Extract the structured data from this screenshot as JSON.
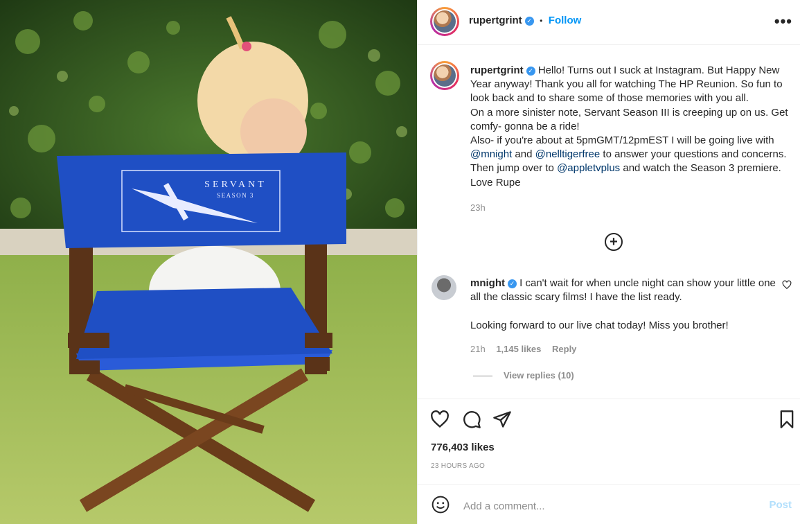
{
  "post": {
    "username": "rupertgrint",
    "verified_icon": "verified-badge-icon",
    "separator": "•",
    "follow_label": "Follow",
    "more_icon": "more-options-icon",
    "more_glyph": "•••"
  },
  "photo": {
    "chair_text_line1": "SERVANT",
    "chair_text_line2": "SEASON 3"
  },
  "caption": {
    "username": "rupertgrint",
    "text_1": " Hello! Turns out I suck at Instagram. But Happy New Year anyway! Thank you all for watching The HP Reunion. So fun to look back and to share some of those memories with you all.",
    "text_2": "On a more sinister note, Servant Season III is creeping up on us. Get comfy- gonna be a ride!",
    "text_3a": "Also- if you're about at 5pmGMT/12pmEST I will be going live with ",
    "mention_1": "@mnight",
    "text_3b": " and ",
    "mention_2": "@nelltigerfree",
    "text_3c": " to answer your questions and concerns. Then jump over to ",
    "mention_3": "@appletvplus",
    "text_3d": " and watch the Season 3 premiere. Love Rupe",
    "time": "23h"
  },
  "load_more_glyph": "+",
  "comment": {
    "username": "mnight",
    "text_1": " I can't wait for when uncle night can show your little one all the classic scary films! I have the list ready.",
    "text_2": "Looking forward to our live chat today! Miss you brother!",
    "time": "21h",
    "likes": "1,145 likes",
    "reply_label": "Reply",
    "view_replies": "View replies (10)"
  },
  "actions": {
    "like_icon": "heart-icon",
    "comment_icon": "comment-bubble-icon",
    "share_icon": "paper-plane-icon",
    "save_icon": "bookmark-icon"
  },
  "stats": {
    "likes": "776,403 likes",
    "time_ago": "23 HOURS AGO"
  },
  "comment_box": {
    "placeholder": "Add a comment...",
    "post_label": "Post"
  },
  "colors": {
    "accent": "#0095f6",
    "verified": "#3897f0",
    "chair_blue": "#1f4fc4",
    "muted_text": "#8e8e8e"
  }
}
